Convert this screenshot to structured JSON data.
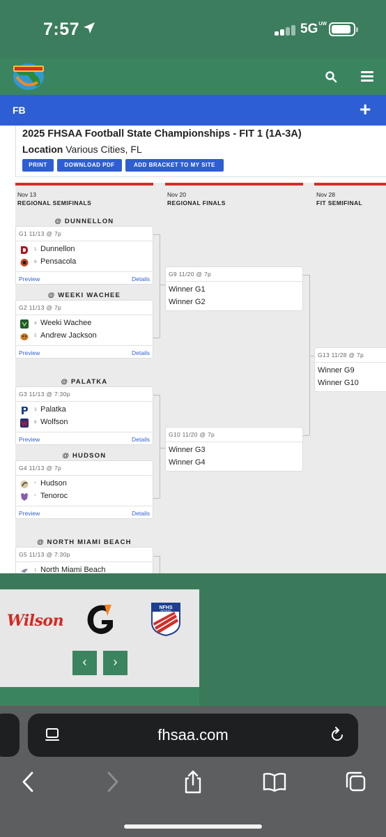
{
  "status_bar": {
    "time": "7:57",
    "network": "5G",
    "network_sub": "UW"
  },
  "site": {
    "logo": "florida-fhsaa-logo",
    "sport_label": "FB"
  },
  "event": {
    "title": "2025 FHSAA Football State Championships - FIT 1 (1A-3A)",
    "location_label": "Location",
    "location_value": "Various Cities, FL",
    "buttons": {
      "print": "PRINT",
      "download": "DOWNLOAD PDF",
      "add": "ADD BRACKET TO MY SITE"
    }
  },
  "rounds": [
    {
      "date": "Nov 13",
      "name": "REGIONAL SEMIFINALS"
    },
    {
      "date": "Nov 20",
      "name": "REGIONAL FINALS"
    },
    {
      "date": "Nov 28",
      "name": "FIT SEMIFINAL"
    }
  ],
  "semifinals": [
    {
      "venue": "@ DUNNELLON",
      "header": "G1 11/13 @ 7p",
      "teams": [
        {
          "seed": "1",
          "name": "Dunnellon",
          "color": "#b0141d"
        },
        {
          "seed": "8",
          "name": "Pensacola",
          "color": "#c8451e"
        }
      ],
      "preview": "Preview",
      "details": "Details"
    },
    {
      "venue": "@ WEEKI WACHEE",
      "header": "G2 11/13 @ 7p",
      "teams": [
        {
          "seed": "4",
          "name": "Weeki Wachee",
          "color": "#1f5a2c"
        },
        {
          "seed": "5",
          "name": "Andrew Jackson",
          "color": "#c57a1d"
        }
      ],
      "preview": "Preview",
      "details": "Details"
    },
    {
      "venue": "@ PALATKA",
      "header": "G3 11/13 @ 7:30p",
      "teams": [
        {
          "seed": "3",
          "name": "Palatka",
          "color": "#1c3f8f"
        },
        {
          "seed": "6",
          "name": "Wolfson",
          "color": "#b01c2c"
        }
      ],
      "preview": "Preview",
      "details": "Details"
    },
    {
      "venue": "@ HUDSON",
      "header": "G4 11/13 @ 7p",
      "teams": [
        {
          "seed": "*",
          "name": "Hudson",
          "color": "#a58b50"
        },
        {
          "seed": "*",
          "name": "Tenoroc",
          "color": "#8a5bb0"
        }
      ],
      "preview": "Preview",
      "details": "Details"
    },
    {
      "venue": "@ NORTH MIAMI BEACH",
      "header": "G5 11/13 @ 7:30p",
      "teams": [
        {
          "seed": "1",
          "name": "North Miami Beach",
          "color": "#8a94a8"
        }
      ]
    }
  ],
  "finals": [
    {
      "header": "G9 11/20 @ 7p",
      "winners": [
        "Winner G1",
        "Winner G2"
      ]
    },
    {
      "header": "G10 11/20 @ 7p",
      "winners": [
        "Winner G3",
        "Winner G4"
      ]
    }
  ],
  "fit_semifinal": {
    "header": "G13 11/28 @ 7p",
    "winners": [
      "Winner G9",
      "Winner G10"
    ]
  },
  "sponsors": {
    "wilson": "Wilson",
    "gatorade_icon": "gatorade-logo",
    "nfhs_text": "NFHS",
    "nfhs_sub": "NETWORK",
    "prev": "‹",
    "next": "›"
  },
  "browser": {
    "url": "fhsaa.com"
  },
  "colors": {
    "header_green": "#3b8460",
    "blue": "#2e5ed3",
    "bracket_red": "#d0302a"
  }
}
